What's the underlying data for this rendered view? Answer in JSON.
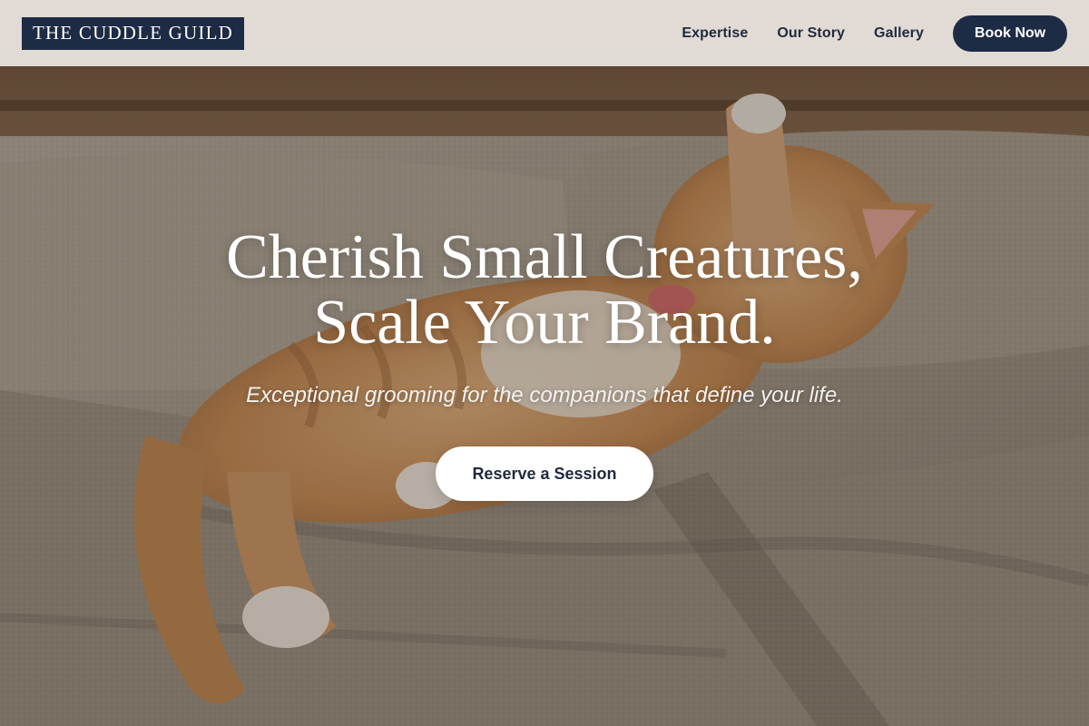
{
  "brand": {
    "logo_text": "THE CUDDLE GUILD"
  },
  "nav": {
    "links": [
      {
        "label": "Expertise"
      },
      {
        "label": "Our Story"
      },
      {
        "label": "Gallery"
      }
    ],
    "cta_label": "Book Now"
  },
  "hero": {
    "title_line1": "Cherish Small Creatures,",
    "title_line2": "Scale Your Brand.",
    "subtitle": "Exceptional grooming for the companions that define your life.",
    "cta_label": "Reserve a Session",
    "background_image": "orange-tabby-cat-stretching-on-couch"
  },
  "colors": {
    "navy": "#1e2b45",
    "header_bg": "#ece6e2",
    "white": "#ffffff"
  }
}
